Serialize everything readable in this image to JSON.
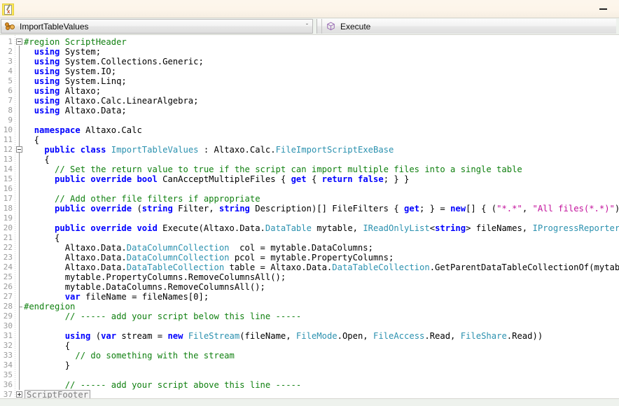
{
  "window": {
    "title": "",
    "app_icon": "script-table-icon",
    "minimize_label": "—"
  },
  "toolbar": {
    "script_selector": {
      "icon": "method-icon",
      "value": "ImportTableValues",
      "arrow": "ˇ"
    },
    "execute": {
      "icon": "cube-icon",
      "label": "Execute"
    }
  },
  "editor": {
    "language": "csharp",
    "first_visible_line": 1,
    "last_visible_line": 37,
    "partial_line_below": 42,
    "colors": {
      "keyword": "#0000ff",
      "type": "#2b91af",
      "comment": "#108010",
      "string": "#c3119c",
      "preprocessor": "#108010",
      "plain": "#000000",
      "line_number": "#9a9a9a",
      "background": "#ffffff"
    },
    "lines": [
      {
        "n": 1,
        "text": "#region ScriptHeader"
      },
      {
        "n": 2,
        "text": "  using System;"
      },
      {
        "n": 3,
        "text": "  using System.Collections.Generic;"
      },
      {
        "n": 4,
        "text": "  using System.IO;"
      },
      {
        "n": 5,
        "text": "  using System.Linq;"
      },
      {
        "n": 6,
        "text": "  using Altaxo;"
      },
      {
        "n": 7,
        "text": "  using Altaxo.Calc.LinearAlgebra;"
      },
      {
        "n": 8,
        "text": "  using Altaxo.Data;"
      },
      {
        "n": 9,
        "text": ""
      },
      {
        "n": 10,
        "text": "  namespace Altaxo.Calc"
      },
      {
        "n": 11,
        "text": "  {"
      },
      {
        "n": 12,
        "text": "    public class ImportTableValues : Altaxo.Calc.FileImportScriptExeBase"
      },
      {
        "n": 13,
        "text": "    {"
      },
      {
        "n": 14,
        "text": "      // Set the return value to true if the script can import multiple files into a single table"
      },
      {
        "n": 15,
        "text": "      public override bool CanAcceptMultipleFiles { get { return false; } }"
      },
      {
        "n": 16,
        "text": ""
      },
      {
        "n": 17,
        "text": "      // Add other file filters if appropriate"
      },
      {
        "n": 18,
        "text": "      public override (string Filter, string Description)[] FileFilters { get; } = new[] { (\"*.*\", \"All files(*.*)\") };"
      },
      {
        "n": 19,
        "text": ""
      },
      {
        "n": 20,
        "text": "      public override void Execute(Altaxo.Data.DataTable mytable, IReadOnlyList<string> fileNames, IProgressReporter reporter)"
      },
      {
        "n": 21,
        "text": "      {"
      },
      {
        "n": 22,
        "text": "        Altaxo.Data.DataColumnCollection  col = mytable.DataColumns;"
      },
      {
        "n": 23,
        "text": "        Altaxo.Data.DataColumnCollection pcol = mytable.PropertyColumns;"
      },
      {
        "n": 24,
        "text": "        Altaxo.Data.DataTableCollection table = Altaxo.Data.DataTableCollection.GetParentDataTableCollectionOf(mytable);"
      },
      {
        "n": 25,
        "text": "        mytable.PropertyColumns.RemoveColumnsAll();"
      },
      {
        "n": 26,
        "text": "        mytable.DataColumns.RemoveColumnsAll();"
      },
      {
        "n": 27,
        "text": "        var fileName = fileNames[0];"
      },
      {
        "n": 28,
        "text": "#endregion"
      },
      {
        "n": 29,
        "text": "        // ----- add your script below this line -----"
      },
      {
        "n": 30,
        "text": ""
      },
      {
        "n": 31,
        "text": "        using (var stream = new FileStream(fileName, FileMode.Open, FileAccess.Read, FileShare.Read))"
      },
      {
        "n": 32,
        "text": "        {"
      },
      {
        "n": 33,
        "text": "          // do something with the stream"
      },
      {
        "n": 34,
        "text": "        }"
      },
      {
        "n": 35,
        "text": ""
      },
      {
        "n": 36,
        "text": "        // ----- add your script above this line -----"
      },
      {
        "n": 37,
        "text": "ScriptFooter"
      }
    ],
    "collapsed_regions": [
      {
        "line": 37,
        "label": "ScriptFooter"
      }
    ],
    "fold_markers": [
      {
        "line": 1,
        "state": "expanded"
      },
      {
        "line": 12,
        "state": "expanded"
      },
      {
        "line": 37,
        "state": "collapsed"
      }
    ]
  },
  "tokens": {
    "note": "Syntax-highlighted spans are built from editor.lines by the template renderer.",
    "keywords": [
      "using",
      "namespace",
      "public",
      "class",
      "override",
      "bool",
      "void",
      "get",
      "return",
      "false",
      "new",
      "var",
      "string"
    ],
    "types": [
      "ImportTableValues",
      "FileImportScriptExeBase",
      "DataTable",
      "IReadOnlyList",
      "IProgressReporter",
      "DataColumnCollection",
      "DataTableCollection",
      "FileStream",
      "FileMode",
      "FileAccess",
      "FileShare"
    ],
    "strings": [
      "\"*.*\"",
      "\"All files(*.*)\""
    ]
  }
}
